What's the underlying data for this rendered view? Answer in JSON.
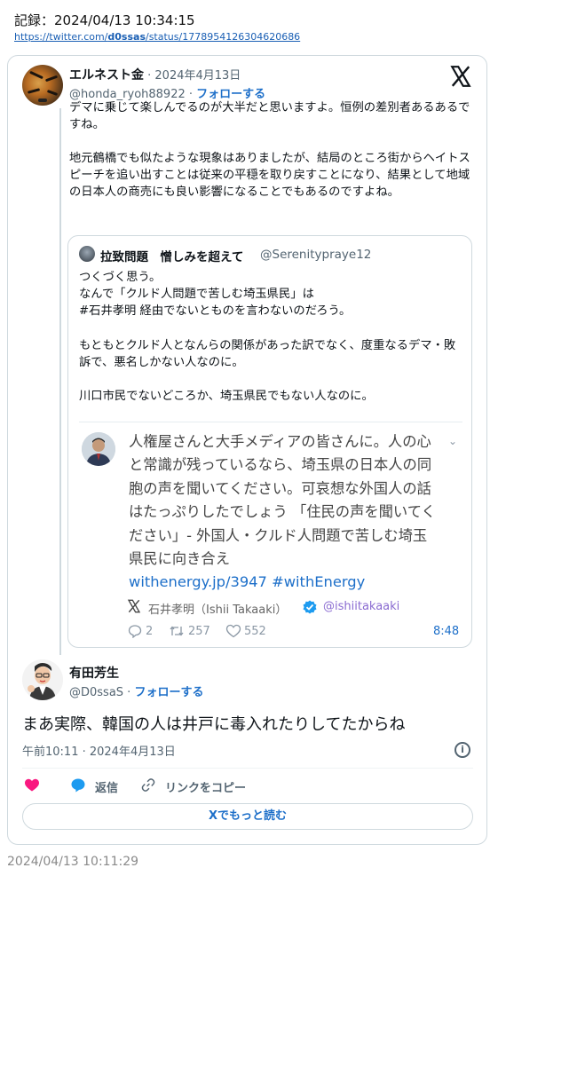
{
  "record": {
    "label": "記録：2024/04/13 10:34:15",
    "link_prefix": "https://twitter.com/",
    "link_user": "d0ssas",
    "link_suffix": "/status/1778954126304620686"
  },
  "reply_tweet": {
    "author": "エルネスト金",
    "date": " · 2024年4月13日",
    "handle": "@honda_ryoh88922",
    "follow": "フォローする",
    "body": "デマに乗じて楽しんでるのが大半だと思いますよ。恒例の差別者あるあるですね。\n\n地元鶴橋でも似たような現象はありましたが、結局のところ街からヘイトスピーチを追い出すことは従来の平穏を取り戻すことになり、結果として地域の日本人の商売にも良い影響になることでもあるのですよね。"
  },
  "quoted_tweet": {
    "author": "拉致問題　憎しみを超えて",
    "handle": "@Serenityprayе12",
    "body": "つくづく思う。\nなんで「クルド人問題で苦しむ埼玉県民」は\n#石井孝明 経由でないとものを言わないのだろう。\n\nもともとクルド人となんらの関係があった訳でなく、度重なるデマ・敗訴で、悪名しかない人なのに。\n\n川口市民でないどころか、埼玉県民でもない人なのに。"
  },
  "embedded_tweet": {
    "body": "人権屋さんと大手メディアの皆さんに。人の心と常識が残っているなら、埼玉県の日本人の同胞の声を聞いてください。可哀想な外国人の話はたっぷりしたでしょう 「住民の声を聞いてください」- 外国人・クルド人問題で苦しむ埼玉県民に向き合え",
    "link": "withenergy.jp/3947 #withEnergy",
    "author": "石井孝明（Ishii Takaaki）",
    "handle": "@ishiitakaaki",
    "replies": "2",
    "retweets": "257",
    "likes": "552",
    "time": "8:48"
  },
  "main_tweet": {
    "author": "有田芳生",
    "handle": "@D0ssaS",
    "follow": "フォローする",
    "text": "まあ実際、韓国の人は井戸に毒入れたりしてたからね",
    "timestamp": "午前10:11 · 2024年4月13日",
    "reply_label": "返信",
    "copy_link_label": "リンクをコピー",
    "read_more": "Xでもっと読む"
  },
  "bottom_timestamp": "2024/04/13 10:11:29",
  "colors": {
    "accent": "#1d6fc9",
    "heart": "#f91880",
    "reply_bubble": "#1d9bf0",
    "verified": "#1d9bf0"
  }
}
